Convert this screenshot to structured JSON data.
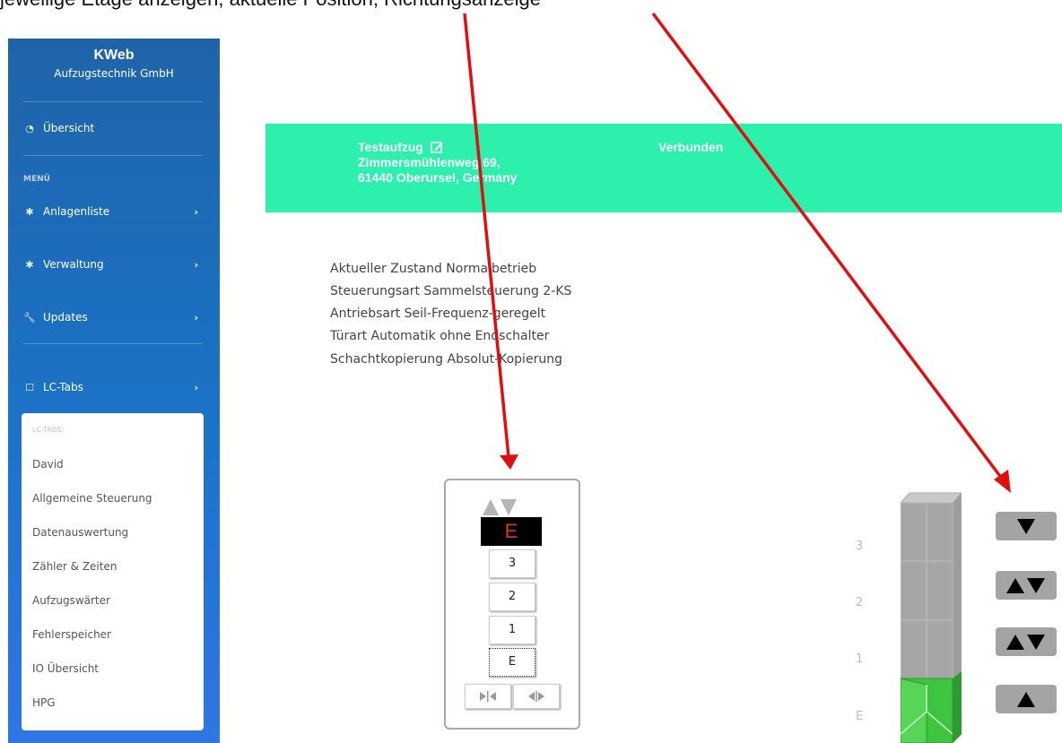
{
  "caption": "jeweilige Etage anzeigen, aktuelle Position, Richtungsanzeige",
  "sidebar": {
    "brand_name": "KWeb",
    "brand_sub": "Aufzugstechnik GmbH",
    "overview": "Übersicht",
    "menu_label": "MENÜ",
    "items": [
      {
        "label": "Anlagenliste",
        "icon": "gear-icon"
      },
      {
        "label": "Verwaltung",
        "icon": "gear-icon"
      },
      {
        "label": "Updates",
        "icon": "wrench-icon"
      },
      {
        "label": "LC-Tabs",
        "icon": "tabs-icon"
      }
    ],
    "submenu_header": "LC-TABS:",
    "submenu": [
      "David",
      "Allgemeine Steuerung",
      "Datenauswertung",
      "Zähler & Zeiten",
      "Aufzugswärter",
      "Fehlerspeicher",
      "IO Übersicht",
      "HPG"
    ]
  },
  "banner": {
    "name": "Testaufzug",
    "street": "Zimmersmühlenweg 69,",
    "city": "61440 Oberursel, Germany",
    "status": "Verbunden",
    "color": "#2df0ad"
  },
  "info_lines": [
    "Aktueller Zustand Normalbetrieb",
    "Steuerungsart Sammelsteuerung 2-KS",
    "Antriebsart Seil-Frequenz-geregelt",
    "Türart Automatik ohne Endschalter",
    "Schachtkopierung Absolut-Kopierung"
  ],
  "panel": {
    "display": "E",
    "floors": [
      "3",
      "2",
      "1",
      "E"
    ],
    "selected_floor": "E"
  },
  "shaft": {
    "floor_labels": [
      "3",
      "2",
      "1",
      "E"
    ],
    "car_floor": "E"
  },
  "colors": {
    "annotation_arrow": "#e01010",
    "car": "#3ec43e",
    "display_text": "#d23b22"
  }
}
